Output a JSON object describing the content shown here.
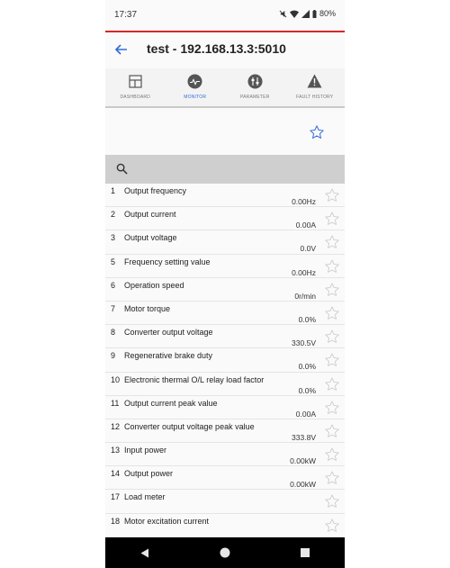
{
  "status_bar": {
    "time": "17:37",
    "battery": "80%"
  },
  "app_bar": {
    "title": "test - 192.168.13.3:5010"
  },
  "tabs": [
    {
      "label": "DASHBOARD",
      "icon": "dashboard-icon"
    },
    {
      "label": "MONITOR",
      "icon": "monitor-icon",
      "active": true
    },
    {
      "label": "PARAMETER",
      "icon": "parameter-icon"
    },
    {
      "label": "FAULT HISTORY",
      "icon": "fault-history-icon"
    }
  ],
  "search": {
    "placeholder": ""
  },
  "monitor_items": [
    {
      "num": "1",
      "name": "Output frequency",
      "value": "0.00Hz"
    },
    {
      "num": "2",
      "name": "Output current",
      "value": "0.00A"
    },
    {
      "num": "3",
      "name": "Output voltage",
      "value": "0.0V"
    },
    {
      "num": "5",
      "name": "Frequency setting value",
      "value": "0.00Hz"
    },
    {
      "num": "6",
      "name": "Operation speed",
      "value": "0r/min"
    },
    {
      "num": "7",
      "name": "Motor torque",
      "value": "0.0%"
    },
    {
      "num": "8",
      "name": "Converter output voltage",
      "value": "330.5V"
    },
    {
      "num": "9",
      "name": "Regenerative brake duty",
      "value": "0.0%"
    },
    {
      "num": "10",
      "name": "Electronic thermal O/L relay load factor",
      "value": "0.0%"
    },
    {
      "num": "11",
      "name": "Output current peak value",
      "value": "0.00A"
    },
    {
      "num": "12",
      "name": "Converter output voltage peak value",
      "value": "333.8V"
    },
    {
      "num": "13",
      "name": "Input power",
      "value": "0.00kW"
    },
    {
      "num": "14",
      "name": "Output power",
      "value": "0.00kW"
    },
    {
      "num": "17",
      "name": "Load meter",
      "value": ""
    },
    {
      "num": "18",
      "name": "Motor excitation current",
      "value": ""
    }
  ],
  "colors": {
    "accent": "#2f6bd8",
    "appbar_border": "#d62828",
    "star": "#c8c8c8"
  }
}
